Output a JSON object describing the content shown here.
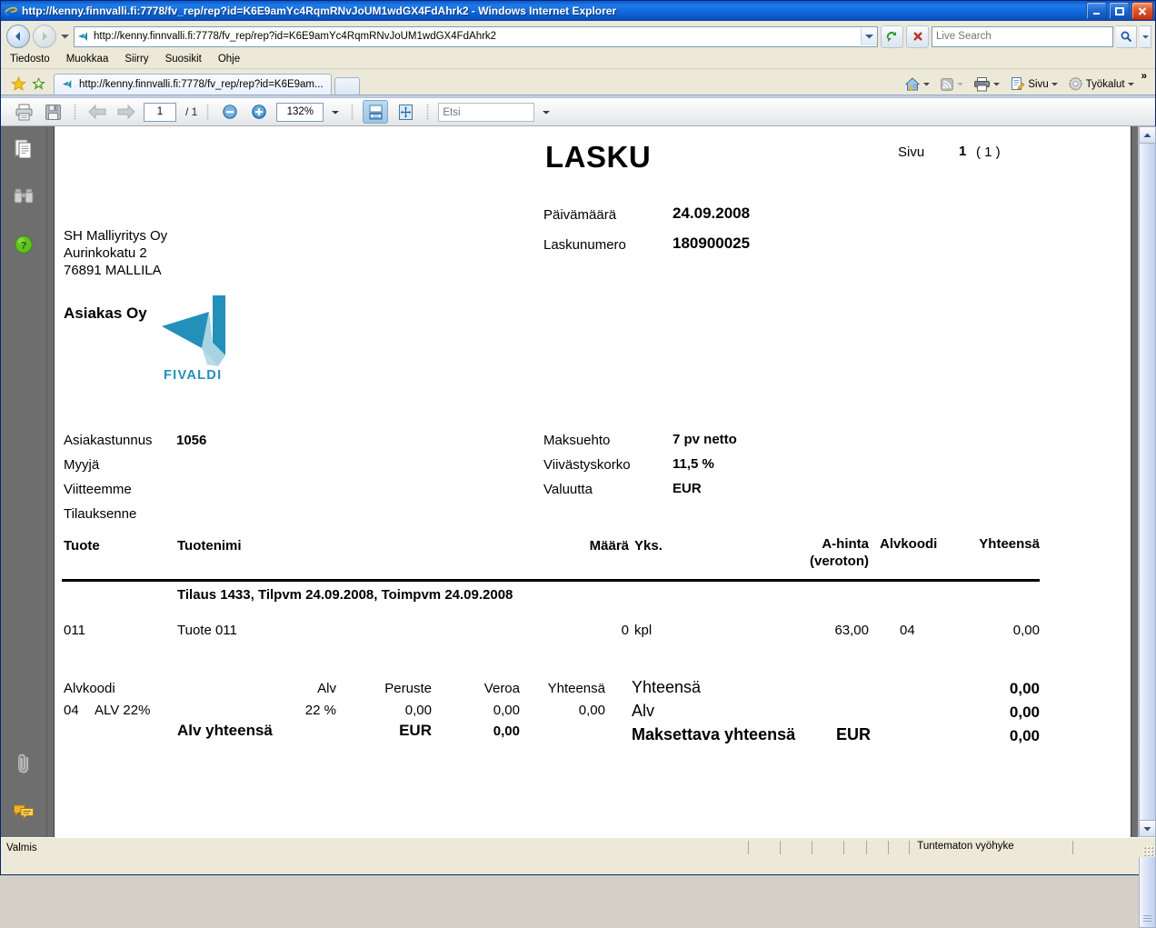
{
  "window": {
    "title": "http://kenny.finnvalli.fi:7778/fv_rep/rep?id=K6E9amYc4RqmRNvJoUM1wdGX4FdAhrk2 - Windows Internet Explorer",
    "minimize_label": "Minimize",
    "maximize_label": "Maximize",
    "close_label": "Close"
  },
  "address_bar": {
    "url": "http://kenny.finnvalli.fi:7778/fv_rep/rep?id=K6E9amYc4RqmRNvJoUM1wdGX4FdAhrk2",
    "search_placeholder": "Live Search",
    "search_value": "",
    "back_label": "Back",
    "forward_label": "Forward",
    "refresh_label": "Refresh",
    "stop_label": "Stop"
  },
  "menu": {
    "items": [
      "Tiedosto",
      "Muokkaa",
      "Siirry",
      "Suosikit",
      "Ohje"
    ]
  },
  "tabs": {
    "favorites_label": "Suosikit",
    "add_favorite_label": "Add to favorites",
    "items": [
      {
        "label": "http://kenny.finnvalli.fi:7778/fv_rep/rep?id=K6E9am...",
        "active": true
      }
    ],
    "new_tab_label": ""
  },
  "command_bar": {
    "home_label": "Home",
    "feeds_label": "Feeds",
    "print_label": "Print",
    "page_label": "Sivu",
    "tools_label": "Työkalut",
    "overflow_label": "»"
  },
  "pdf_toolbar": {
    "print_label": "Print",
    "save_label": "Save",
    "prev_label": "Previous page",
    "next_label": "Next page",
    "page_current": "1",
    "page_total": "/ 1",
    "zoom_out_label": "Zoom out",
    "zoom_in_label": "Zoom in",
    "zoom_value": "132%",
    "fit_width_label": "Fit width",
    "fit_page_label": "Fit page",
    "find_placeholder": "Etsi",
    "find_value": ""
  },
  "left_rail": {
    "pages_label": "Pages",
    "search_label": "Search",
    "help_label": "Help",
    "attachments_label": "Attachments",
    "comments_label": "Comments"
  },
  "status_bar": {
    "left_text": "Valmis",
    "zone_text": "Tuntematon vyöhyke"
  },
  "invoice": {
    "logo_text": "FIVALDI",
    "sender": {
      "name": "SH Malliyritys Oy",
      "street": "Aurinkokatu 2",
      "city": "76891 MALLILA"
    },
    "recipient": "Asiakas Oy",
    "title": "LASKU",
    "page_label": "Sivu",
    "page_number": "1",
    "page_of": "( 1 )",
    "header_fields": [
      {
        "label": "Päivämäärä",
        "value": "24.09.2008"
      },
      {
        "label": "Laskunumero",
        "value": "180900025"
      }
    ],
    "left_fields": [
      {
        "label": "Asiakastunnus",
        "value": "1056"
      },
      {
        "label": "Myyjä",
        "value": ""
      },
      {
        "label": "Viitteemme",
        "value": ""
      },
      {
        "label": "Tilauksenne",
        "value": ""
      }
    ],
    "right_fields": [
      {
        "label": "Maksuehto",
        "value": "7 pv netto"
      },
      {
        "label": "Viivästyskorko",
        "value": "11,5 %"
      },
      {
        "label": "Valuutta",
        "value": "EUR"
      }
    ],
    "table": {
      "headers": {
        "product": "Tuote",
        "name": "Tuotenimi",
        "qty": "Määrä",
        "unit": "Yks.",
        "price": "A-hinta",
        "price_sub": "(veroton)",
        "vatcode": "Alvkoodi",
        "total": "Yhteensä"
      },
      "group_row": "Tilaus 1433, Tilpvm 24.09.2008, Toimpvm 24.09.2008",
      "rows": [
        {
          "product": "011",
          "name": "Tuote 011",
          "qty": "0",
          "unit": "kpl",
          "price": "63,00",
          "vatcode": "04",
          "total": "0,00"
        }
      ]
    },
    "vat_summary": {
      "headers": {
        "code": "Alvkoodi",
        "vat": "Alv",
        "base": "Peruste",
        "tax": "Veroa",
        "total": "Yhteensä"
      },
      "rows": [
        {
          "code": "04",
          "name": "ALV 22%",
          "vat": "22 %",
          "base": "0,00",
          "tax": "0,00",
          "total": "0,00"
        }
      ],
      "total_label": "Alv yhteensä",
      "total_currency": "EUR",
      "total_value": "0,00"
    },
    "totals": [
      {
        "label": "Yhteensä",
        "currency": "",
        "value": "0,00",
        "bold": false
      },
      {
        "label": "Alv",
        "currency": "",
        "value": "0,00",
        "bold": false
      },
      {
        "label": "Maksettava yhteensä",
        "currency": "EUR",
        "value": "0,00",
        "bold": true
      }
    ]
  },
  "colors": {
    "titlebar_blue": "#1f7ae6",
    "logo_teal": "#1f8bb5",
    "logo_teal_light": "#a9d3e3",
    "viewer_gray": "#6e6e6e",
    "chrome_beige": "#ece9d8"
  }
}
